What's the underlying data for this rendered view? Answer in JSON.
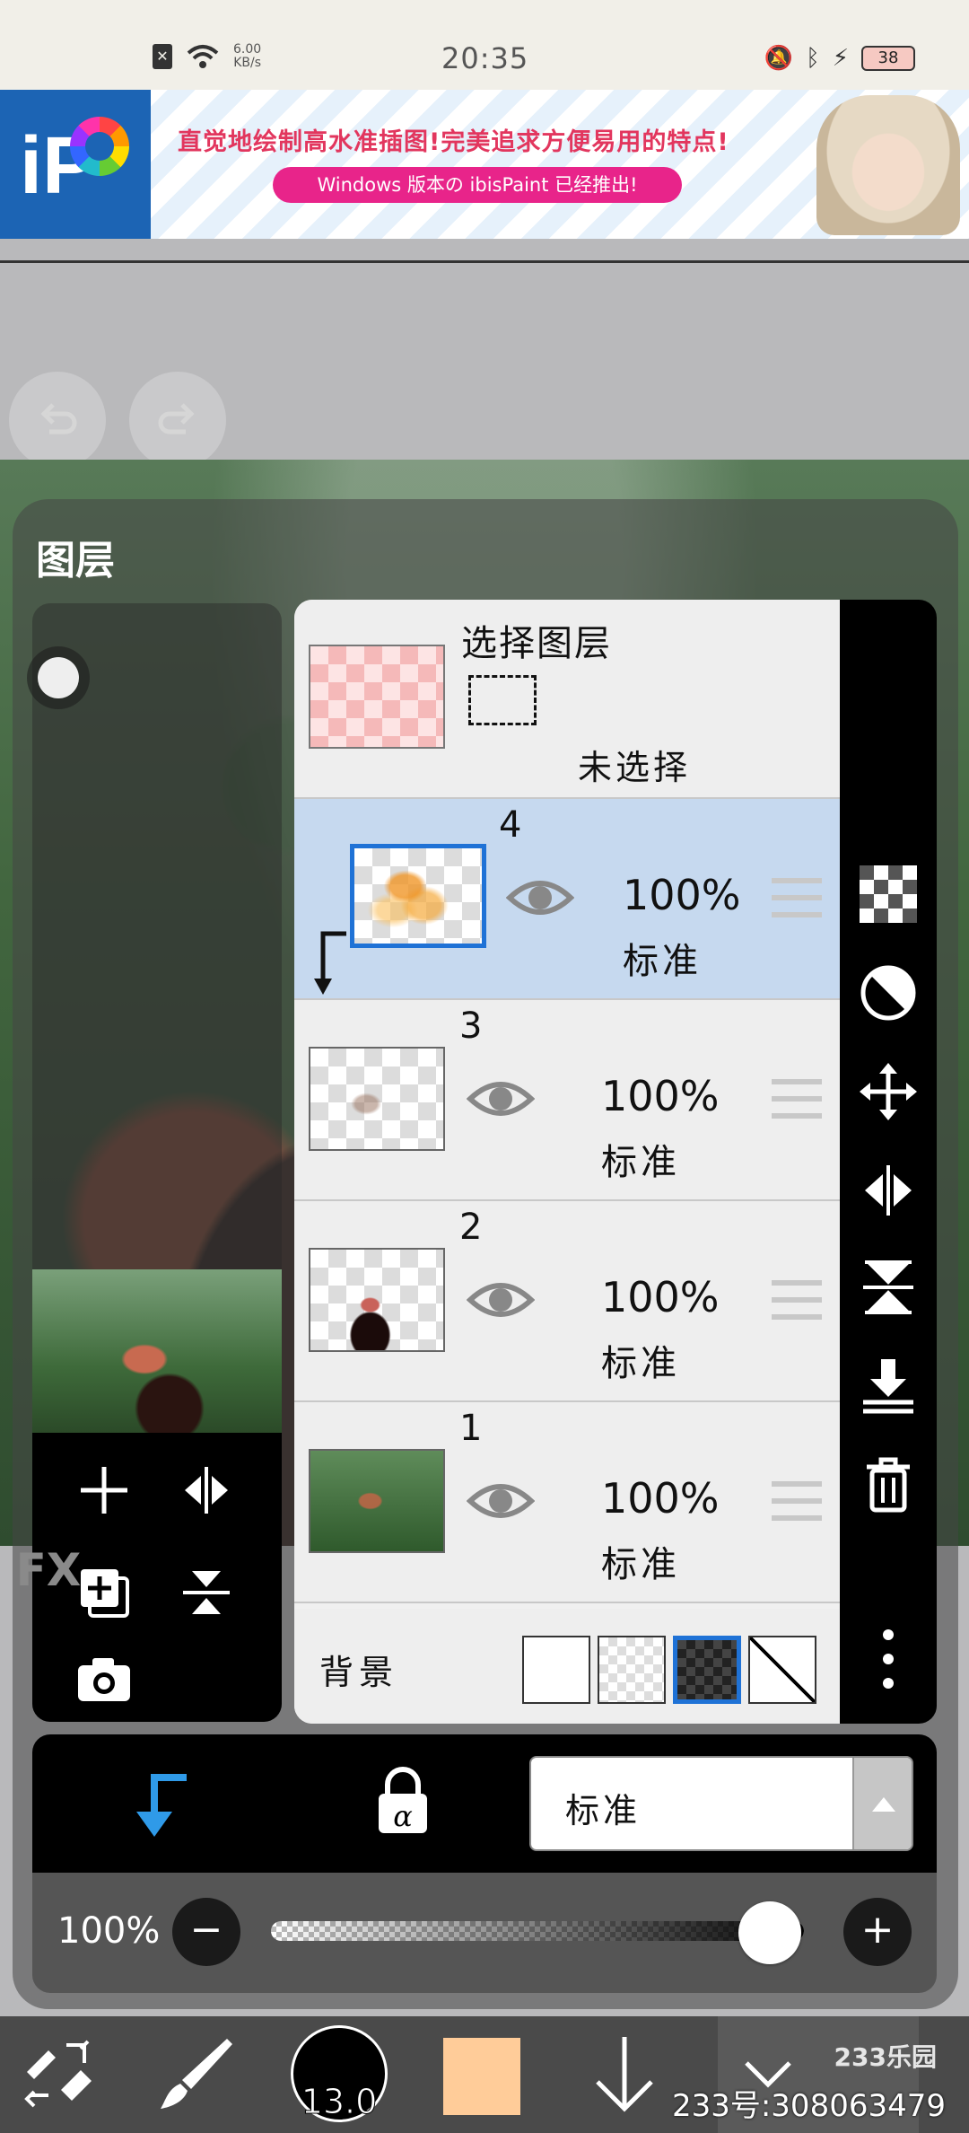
{
  "status_bar": {
    "net_speed": "6.00\nKB/s",
    "time": "20:35",
    "battery": "38"
  },
  "banner": {
    "headline": "直觉地绘制高水准插图!完美追求方便易用的特点!",
    "pill": "Windows 版本の ibisPaint 已经推出!",
    "logo_text": "iP"
  },
  "panel": {
    "title": "图层"
  },
  "selection_layer": {
    "title": "选择图层",
    "status": "未选择"
  },
  "layers": [
    {
      "number": "4",
      "opacity": "100%",
      "mode": "标准",
      "active": true
    },
    {
      "number": "3",
      "opacity": "100%",
      "mode": "标准",
      "active": false
    },
    {
      "number": "2",
      "opacity": "100%",
      "mode": "标准",
      "active": false
    },
    {
      "number": "1",
      "opacity": "100%",
      "mode": "标准",
      "active": false
    }
  ],
  "background_row": {
    "label": "背景",
    "options": [
      "white",
      "transparent",
      "dark-checker",
      "none"
    ],
    "selected": "dark-checker"
  },
  "right_toolbar": {
    "fx_label": "FX",
    "icons": [
      "checker-icon",
      "circle-half-icon",
      "move-icon",
      "flip-horizontal-icon",
      "flip-vertical-icon",
      "merge-down-icon",
      "trash-icon",
      "more-icon"
    ]
  },
  "blend": {
    "mode": "标准"
  },
  "opacity": {
    "label": "100%",
    "value": 1.0,
    "minus": "−",
    "plus": "+"
  },
  "bottom_toolbar": {
    "brush_size": "13.0",
    "color": "#ffcc99"
  },
  "watermark": {
    "logo": "233乐园",
    "text": "233号:308063479"
  },
  "colors": {
    "accent": "#1f72d6",
    "active_layer_bg": "#c6d9ef",
    "banner_pink": "#e8248a",
    "banner_blue": "#1c64b4"
  }
}
